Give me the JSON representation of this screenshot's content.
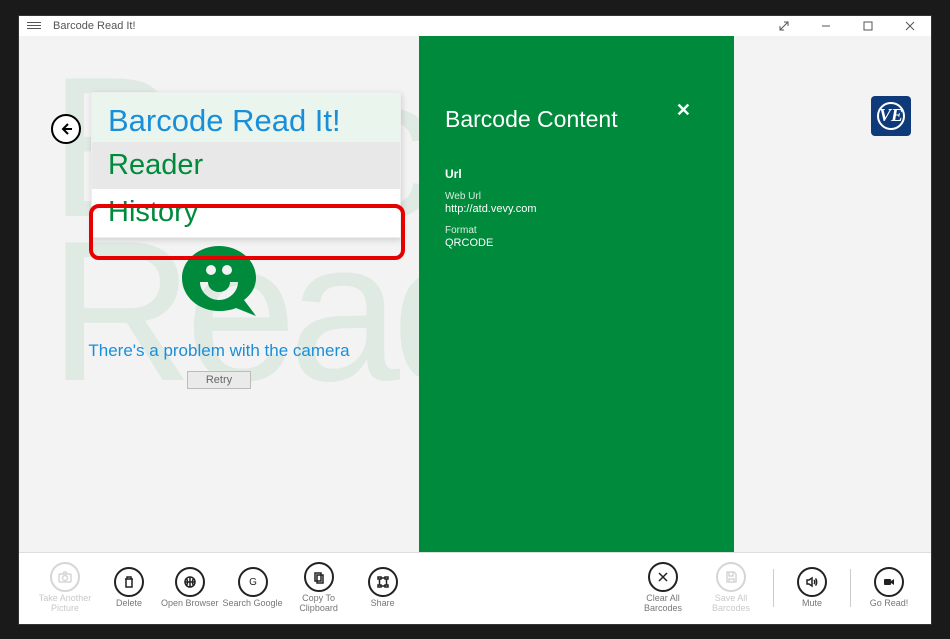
{
  "window": {
    "title": "Barcode Read It!"
  },
  "dropdown": {
    "header": "Barcode Read It!",
    "item_reader": "Reader",
    "item_history": "History"
  },
  "camera": {
    "message": "There's a problem with the camera",
    "retry": "Retry"
  },
  "panel": {
    "title": "Barcode Content",
    "section": "Url",
    "weburl_label": "Web Url",
    "weburl_value": "http://atd.vevy.com",
    "format_label": "Format",
    "format_value": "QRCODE"
  },
  "logo": {
    "text": "VE"
  },
  "toolbar": {
    "take": "Take Another Picture",
    "delete": "Delete",
    "browser": "Open Browser",
    "google": "Search Google",
    "copy": "Copy To Clipboard",
    "share": "Share",
    "clear": "Clear All Barcodes",
    "save": "Save All Barcodes",
    "mute": "Mute",
    "goread": "Go Read!"
  }
}
